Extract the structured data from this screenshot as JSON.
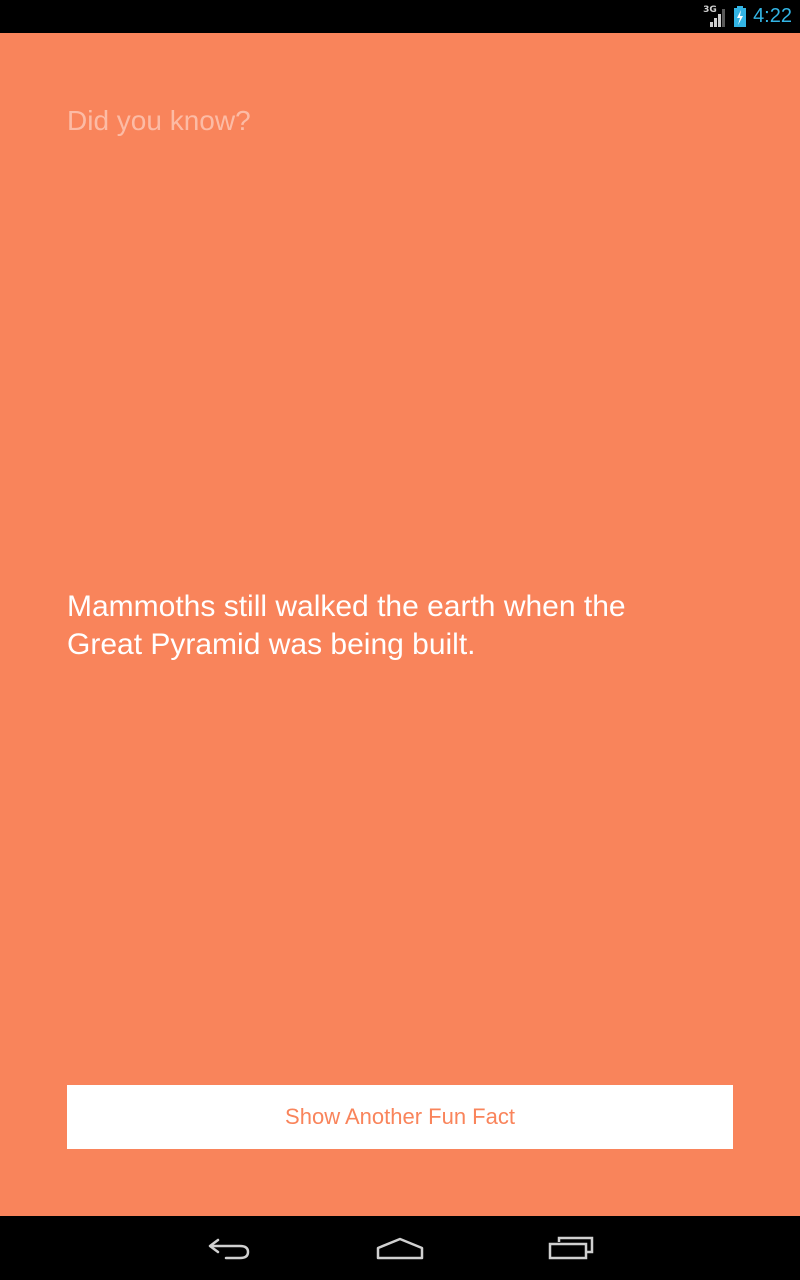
{
  "status_bar": {
    "network_type": "3G",
    "time": "4:22",
    "signal_icon": "signal-bars-icon",
    "battery_icon": "battery-charging-icon",
    "clock_color": "#33b5e5"
  },
  "app": {
    "background_color": "#f9845b",
    "heading": "Did you know?",
    "fact": "Mammoths still walked the earth when the Great Pyramid was being built.",
    "button_label": "Show Another Fun Fact",
    "button_text_color": "#f9845b"
  },
  "nav_bar": {
    "back_icon": "back-arrow-icon",
    "home_icon": "home-icon",
    "recents_icon": "recent-apps-icon"
  }
}
